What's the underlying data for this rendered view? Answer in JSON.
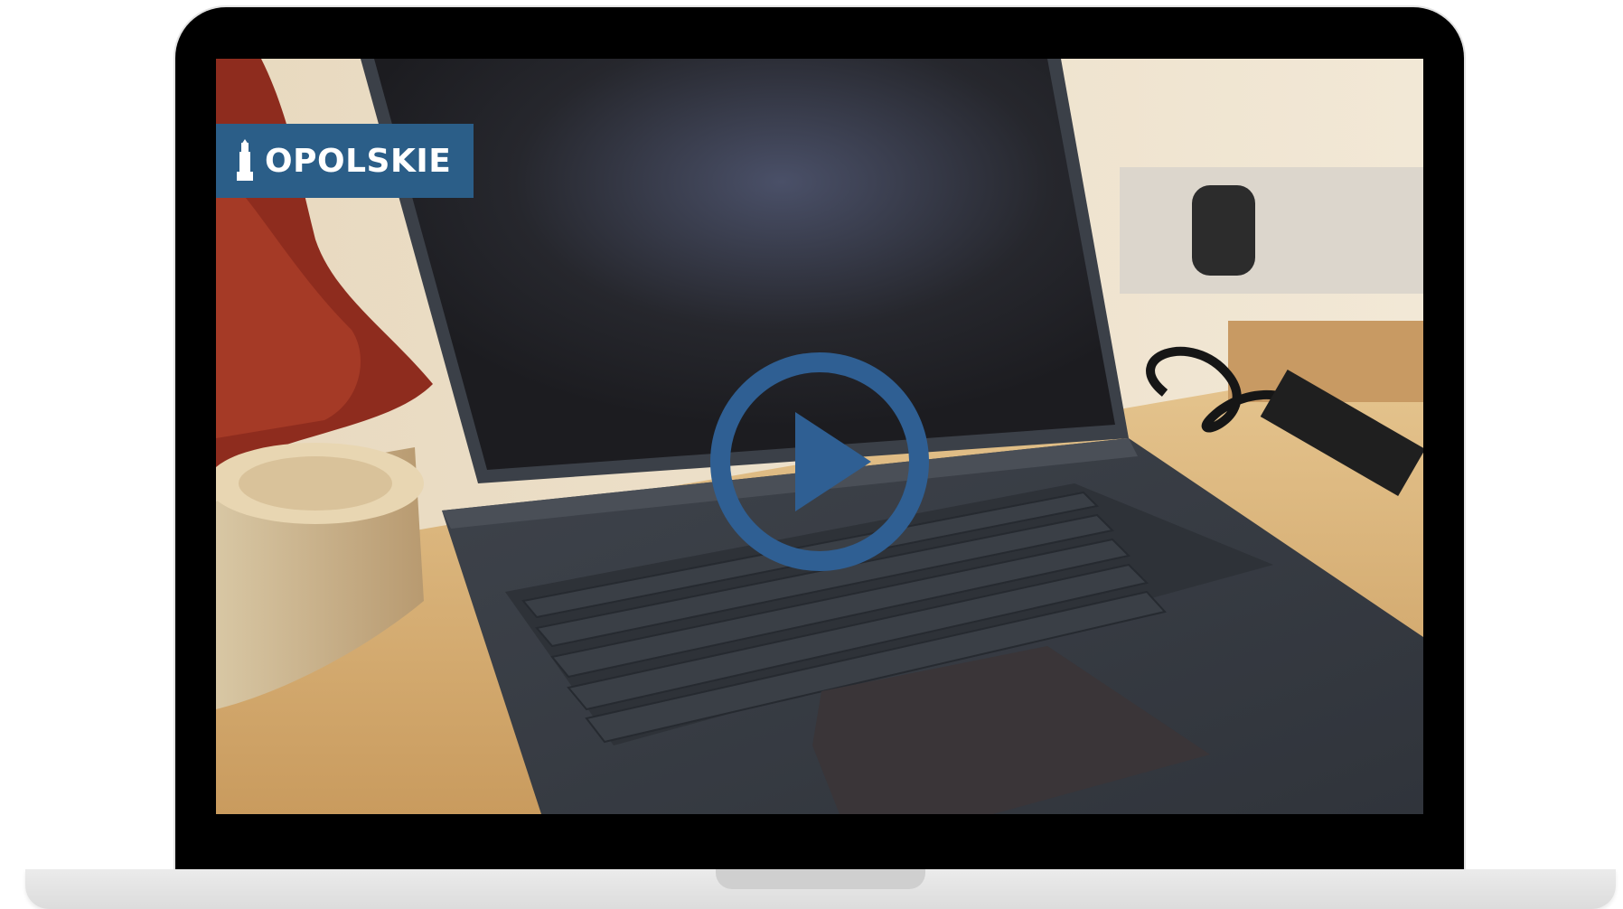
{
  "video": {
    "logo_text": "OPOLSKIE",
    "logo_icon": "tower-icon",
    "play_icon": "play-icon"
  },
  "colors": {
    "logo_background": "#2b5e88",
    "play_ring": "#2f5f93"
  }
}
